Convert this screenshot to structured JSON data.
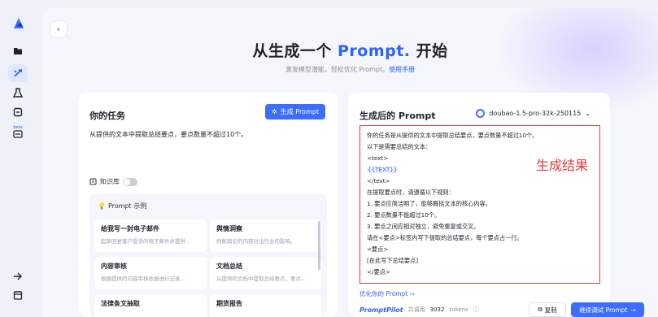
{
  "rail": {
    "logo": "app-logo",
    "items": [
      {
        "icon": "folder-icon"
      },
      {
        "icon": "prompt-tools-icon",
        "active": true
      },
      {
        "icon": "flask-icon"
      },
      {
        "icon": "share-icon"
      },
      {
        "icon": "beta-badge-icon",
        "badge": "beta"
      },
      {
        "icon": "arrow-right-icon"
      },
      {
        "icon": "calendar-icon"
      }
    ]
  },
  "hero": {
    "title_prefix": "从生成一个",
    "title_accent": "Prompt.",
    "title_suffix": "开始",
    "subtitle": "激发模型潜能，轻松优化 Prompt。",
    "subtitle_link": "使用手册"
  },
  "task": {
    "title": "你的任务",
    "generate_button": "生成 Prompt",
    "text": "从提供的文本中提取总结要点，要点数量不超过10个。",
    "knowledge_base_label": "知识库",
    "examples_title": "Prompt 示例",
    "examples": [
      {
        "title": "给我写一封电子邮件",
        "desc": "起草回复客户投诉的电子邮件并提供..."
      },
      {
        "title": "舆情洞察",
        "desc": "判断舆论的内容对出行业的影响。"
      },
      {
        "title": "内容审核",
        "desc": "根据提供的内容审核依据进行记录..."
      },
      {
        "title": "文档总结",
        "desc": "从提供的文档中提取总结要点，要点..."
      },
      {
        "title": "法律条文抽取",
        "desc": ""
      },
      {
        "title": "期货报告",
        "desc": ""
      }
    ]
  },
  "result": {
    "title": "生成后的 Prompt",
    "model": "doubao-1.5-pro-32k-250115",
    "lines": [
      "你的任务是从提供的文本中提取总结要点，要点数量不超过10个。",
      "以下是需要总结的文本：",
      "<text>",
      "{{TEXT}}",
      "</text>",
      "在提取要点时，请遵循以下规则：",
      "1. 要点应简洁明了，能够概括文本的核心内容。",
      "2. 要点数量不能超过10个。",
      "3. 要点之间应相对独立，避免重复或交叉。",
      "请在<要点>标签内写下提取的总结要点，每个要点占一行。",
      "<要点>",
      "[在此写下总结要点]",
      "</要点>"
    ],
    "annotation": "生成结果",
    "optimize_link": "优化你的 Prompt ⤳",
    "brand": "PromptPilot",
    "usage_prefix": "共调用",
    "usage_tokens": "3032",
    "usage_suffix": "tokens",
    "copy_button": "复制",
    "debug_button": "继续调试 Prompt"
  },
  "colors": {
    "accent": "#2e61ff",
    "button": "#3d6dfd",
    "annotation": "#e53935"
  }
}
